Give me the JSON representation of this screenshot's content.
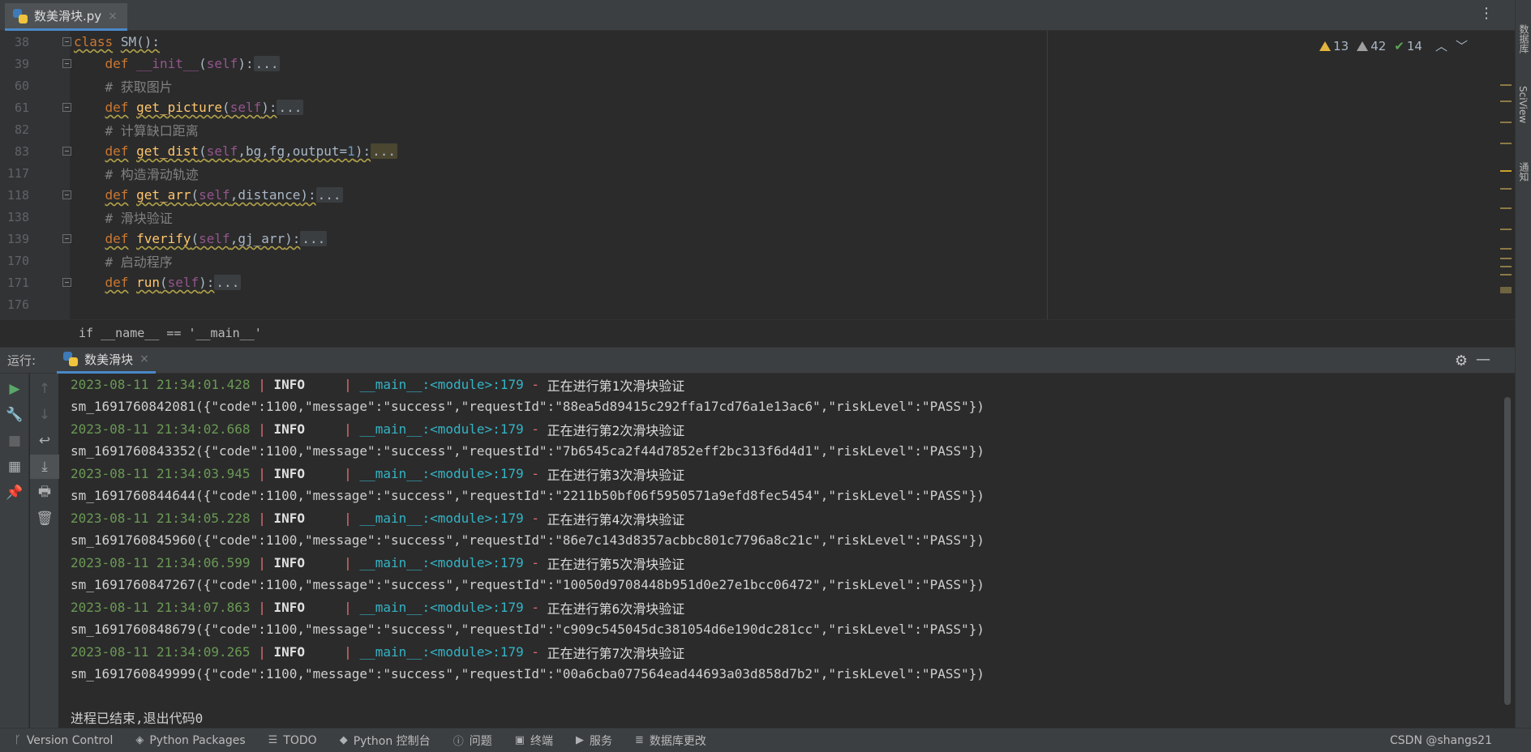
{
  "tab": {
    "filename": "数美滑块.py",
    "close": "×"
  },
  "inspections": {
    "warnings": "13",
    "weak_warnings": "42",
    "ok": "14"
  },
  "code_lines": [
    {
      "ln": "38",
      "fold": true
    },
    {
      "ln": "39",
      "fold": true
    },
    {
      "ln": "60",
      "fold": false,
      "comment": "# 获取图片"
    },
    {
      "ln": "61",
      "fold": true
    },
    {
      "ln": "82",
      "fold": false,
      "comment": "# 计算缺口距离"
    },
    {
      "ln": "83",
      "fold": true
    },
    {
      "ln": "117",
      "fold": false,
      "comment": "# 构造滑动轨迹"
    },
    {
      "ln": "118",
      "fold": true
    },
    {
      "ln": "138",
      "fold": false,
      "comment": "# 滑块验证"
    },
    {
      "ln": "139",
      "fold": true
    },
    {
      "ln": "170",
      "fold": false,
      "comment": "# 启动程序"
    },
    {
      "ln": "171",
      "fold": true
    },
    {
      "ln": "176",
      "fold": false
    }
  ],
  "code_tokens": {
    "class_kw": "class",
    "class_name": "SM():",
    "def_kw": "def",
    "init_name": "__init__",
    "self": "self",
    "paren_close": "):",
    "ellipsis": "...",
    "get_picture": "get_picture",
    "get_dist": "get_dist",
    "dist_args_a": ",bg,fg,output=",
    "dist_num": "1",
    "get_arr": "get_arr",
    "arr_args": ",distance",
    "fverify": "fverify",
    "fverify_args": ",gj_arr",
    "run": "run",
    "open_paren": "("
  },
  "breadcrumb": "if __name__ == '__main__'",
  "run_panel": {
    "label": "运行:",
    "tab": "数美滑块",
    "close": "×"
  },
  "console": {
    "logs": [
      {
        "ts": "2023-08-11 21:34:01.428",
        "level": "INFO",
        "mod": "__main__:<module>:179",
        "msg": "正在进行第1次滑块验证",
        "out": "sm_1691760842081({\"code\":1100,\"message\":\"success\",\"requestId\":\"88ea5d89415c292ffa17cd76a1e13ac6\",\"riskLevel\":\"PASS\"})"
      },
      {
        "ts": "2023-08-11 21:34:02.668",
        "level": "INFO",
        "mod": "__main__:<module>:179",
        "msg": "正在进行第2次滑块验证",
        "out": "sm_1691760843352({\"code\":1100,\"message\":\"success\",\"requestId\":\"7b6545ca2f44d7852eff2bc313f6d4d1\",\"riskLevel\":\"PASS\"})"
      },
      {
        "ts": "2023-08-11 21:34:03.945",
        "level": "INFO",
        "mod": "__main__:<module>:179",
        "msg": "正在进行第3次滑块验证",
        "out": "sm_1691760844644({\"code\":1100,\"message\":\"success\",\"requestId\":\"2211b50bf06f5950571a9efd8fec5454\",\"riskLevel\":\"PASS\"})"
      },
      {
        "ts": "2023-08-11 21:34:05.228",
        "level": "INFO",
        "mod": "__main__:<module>:179",
        "msg": "正在进行第4次滑块验证",
        "out": "sm_1691760845960({\"code\":1100,\"message\":\"success\",\"requestId\":\"86e7c143d8357acbbc801c7796a8c21c\",\"riskLevel\":\"PASS\"})"
      },
      {
        "ts": "2023-08-11 21:34:06.599",
        "level": "INFO",
        "mod": "__main__:<module>:179",
        "msg": "正在进行第5次滑块验证",
        "out": "sm_1691760847267({\"code\":1100,\"message\":\"success\",\"requestId\":\"10050d9708448b951d0e27e1bcc06472\",\"riskLevel\":\"PASS\"})"
      },
      {
        "ts": "2023-08-11 21:34:07.863",
        "level": "INFO",
        "mod": "__main__:<module>:179",
        "msg": "正在进行第6次滑块验证",
        "out": "sm_1691760848679({\"code\":1100,\"message\":\"success\",\"requestId\":\"c909c545045dc381054d6e190dc281cc\",\"riskLevel\":\"PASS\"})"
      },
      {
        "ts": "2023-08-11 21:34:09.265",
        "level": "INFO",
        "mod": "__main__:<module>:179",
        "msg": "正在进行第7次滑块验证",
        "out": "sm_1691760849999({\"code\":1100,\"message\":\"success\",\"requestId\":\"00a6cba077564ead44693a03d858d7b2\",\"riskLevel\":\"PASS\"})"
      }
    ],
    "exit_message": "进程已结束,退出代码0"
  },
  "right_strip": [
    "数据库",
    "SciView",
    "通知"
  ],
  "statusbar": {
    "items": [
      "Version Control",
      "Python Packages",
      "TODO",
      "Python 控制台",
      "问题",
      "终端",
      "服务",
      "数据库更改"
    ],
    "watermark": "CSDN @shangs21"
  }
}
